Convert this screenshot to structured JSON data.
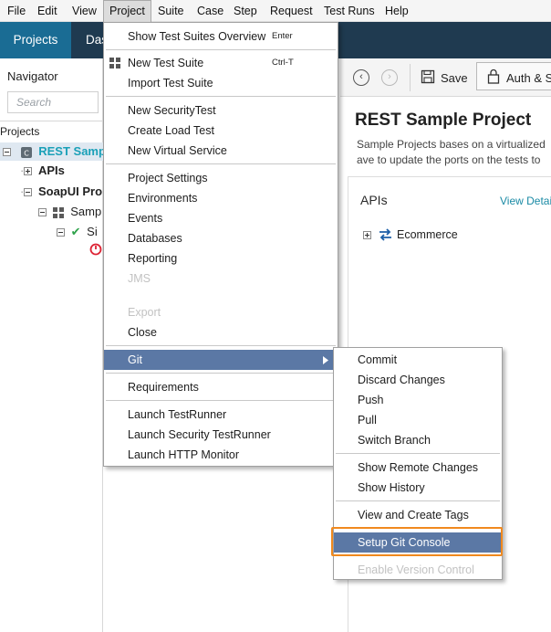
{
  "menubar": {
    "items": [
      "File",
      "Edit",
      "View",
      "Project",
      "Suite",
      "Case",
      "Step",
      "Request",
      "Test Runs",
      "Help"
    ]
  },
  "tabs": {
    "projects": "Projects",
    "dashboard_partial": "Das"
  },
  "navigator": {
    "title": "Navigator",
    "search_placeholder": "Search",
    "projects_label": "Projects",
    "tree": {
      "rest_sample": "REST Samp",
      "apis": "APIs",
      "soapui_pro": "SoapUI Pro",
      "sample": "Samp",
      "si": "Si"
    }
  },
  "toolbar": {
    "save": "Save",
    "auth": "Auth & S"
  },
  "project": {
    "title": "REST Sample Project",
    "desc_line1": "Sample Projects bases on a virtualized",
    "desc_line2": "ave to update the ports on the tests to",
    "apis_header": "APIs",
    "view_details": "View Detai",
    "api_item": "Ecommerce"
  },
  "project_menu": {
    "show_overview": "Show Test Suites Overview",
    "show_overview_shortcut": "Enter",
    "new_test_suite": "New Test Suite",
    "new_test_suite_shortcut": "Ctrl-T",
    "import_test_suite": "Import Test Suite",
    "new_security_test": "New SecurityTest",
    "create_load_test": "Create Load Test",
    "new_virtual_service": "New Virtual Service",
    "project_settings": "Project Settings",
    "environments": "Environments",
    "events": "Events",
    "databases": "Databases",
    "reporting": "Reporting",
    "jms": "JMS",
    "export": "Export",
    "close": "Close",
    "git": "Git",
    "requirements": "Requirements",
    "launch_testrunner": "Launch TestRunner",
    "launch_security_testrunner": "Launch Security TestRunner",
    "launch_http_monitor": "Launch HTTP Monitor"
  },
  "git_menu": {
    "commit": "Commit",
    "discard_changes": "Discard Changes",
    "push": "Push",
    "pull": "Pull",
    "switch_branch": "Switch Branch",
    "show_remote_changes": "Show Remote Changes",
    "show_history": "Show History",
    "view_create_tags": "View and Create Tags",
    "setup_git_console": "Setup Git Console",
    "enable_version_control": "Enable Version Control"
  },
  "colors": {
    "tabbar": "#1f3a50",
    "selected_tab": "#1a6c94",
    "menu_highlight": "#5b78a5",
    "focus_ring": "#f0891e",
    "link": "#1a8aa5"
  }
}
